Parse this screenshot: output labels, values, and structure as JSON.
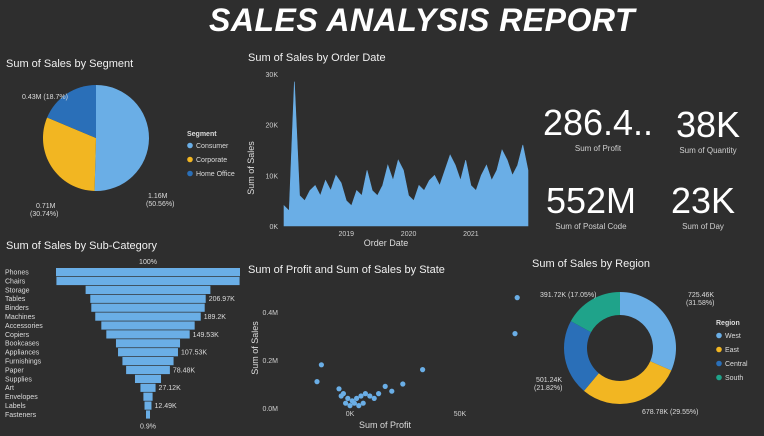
{
  "report_title": "SALES ANALYSIS REPORT",
  "colors": {
    "background": "#2e2e2e",
    "light_blue": "#6aaee6",
    "gold": "#f2b622",
    "mid_blue": "#2a6fb8",
    "teal": "#1fa38a"
  },
  "segment_chart": {
    "title": "Sum of Sales by Segment",
    "legend_title": "Segment",
    "chart_data": {
      "type": "pie",
      "title": "Sum of Sales by Segment",
      "categories": [
        "Consumer",
        "Corporate",
        "Home Office"
      ],
      "values": [
        1.16,
        0.71,
        0.43
      ],
      "value_labels": [
        "1.16M",
        "0.71M",
        "0.43M"
      ],
      "percent_labels": [
        "(50.56%)",
        "(30.74%)",
        "(18.7%)"
      ],
      "unit": "M"
    },
    "slice_labels": {
      "consumer_value": "1.16M",
      "consumer_pct": "(50.56%)",
      "corporate_value": "0.71M",
      "corporate_pct": "(30.74%)",
      "home_office": "0.43M (18.7%)"
    }
  },
  "order_date_chart": {
    "title": "Sum of Sales by Order Date",
    "xlabel": "Order Date",
    "ylabel": "Sum of Sales",
    "y_ticks": [
      "30K",
      "20K",
      "10K",
      "0K"
    ],
    "x_ticks": [
      "2019",
      "2020",
      "2021"
    ],
    "chart_data": {
      "type": "area",
      "title": "Sum of Sales by Order Date",
      "xlabel": "Order Date",
      "ylabel": "Sum of Sales",
      "ylim": [
        0,
        30000
      ],
      "x_range": [
        "2018-01",
        "2021-12"
      ],
      "series": [
        {
          "x": [
            "2018-01",
            "2018-02",
            "2018-03",
            "2018-04",
            "2018-05",
            "2018-06",
            "2018-07",
            "2018-08",
            "2018-09",
            "2018-10",
            "2018-11",
            "2018-12",
            "2019-01",
            "2019-02",
            "2019-03",
            "2019-04",
            "2019-05",
            "2019-06",
            "2019-07",
            "2019-08",
            "2019-09",
            "2019-10",
            "2019-11",
            "2019-12",
            "2020-01",
            "2020-02",
            "2020-03",
            "2020-04",
            "2020-05",
            "2020-06",
            "2020-07",
            "2020-08",
            "2020-09",
            "2020-10",
            "2020-11",
            "2020-12",
            "2021-01",
            "2021-02",
            "2021-03",
            "2021-04",
            "2021-05",
            "2021-06",
            "2021-07",
            "2021-08",
            "2021-09",
            "2021-10",
            "2021-11",
            "2021-12"
          ],
          "values": [
            4000,
            3000,
            28500,
            6000,
            5000,
            7000,
            8000,
            6000,
            9000,
            7000,
            10000,
            8500,
            5000,
            4000,
            7000,
            6000,
            11000,
            7000,
            6000,
            8000,
            12000,
            9000,
            13000,
            11000,
            6000,
            5000,
            8000,
            7000,
            9000,
            10000,
            8000,
            11000,
            14000,
            12000,
            9000,
            13000,
            8000,
            7000,
            10000,
            12000,
            9000,
            11000,
            15000,
            13000,
            10000,
            12000,
            16000,
            11000
          ]
        }
      ]
    }
  },
  "kpis": [
    {
      "value": "286.4..",
      "label": "Sum of Profit"
    },
    {
      "value": "38K",
      "label": "Sum of Quantity"
    },
    {
      "value": "552M",
      "label": "Sum of Postal Code"
    },
    {
      "value": "23K",
      "label": "Sum of Day"
    }
  ],
  "subcategory_chart": {
    "title": "Sum of Sales by Sub-Category",
    "chart_data": {
      "type": "bar",
      "title": "Sum of Sales by Sub-Category",
      "categories": [
        "Phones",
        "Chairs",
        "Storage",
        "Tables",
        "Binders",
        "Machines",
        "Accessories",
        "Copiers",
        "Bookcases",
        "Appliances",
        "Furnishings",
        "Paper",
        "Supplies",
        "Art",
        "Envelopes",
        "Labels",
        "Fasteners"
      ],
      "values": [
        330.0,
        328.5,
        223.8,
        206.97,
        203.4,
        189.2,
        167.4,
        149.53,
        114.9,
        107.53,
        91.7,
        78.48,
        46.7,
        27.12,
        16.5,
        12.49,
        3.0
      ],
      "unit": "K",
      "data_labels": {
        "0": "100%",
        "3": "206.97K",
        "5": "189.2K",
        "7": "149.53K",
        "9": "107.53K",
        "11": "78.48K",
        "13": "27.12K",
        "15": "12.49K",
        "16": "0.9%"
      }
    }
  },
  "state_chart": {
    "title": "Sum of Profit and Sum of Sales by State",
    "xlabel": "Sum of Profit",
    "ylabel": "Sum of Sales",
    "y_ticks": [
      "0.4M",
      "0.2M",
      "0.0M"
    ],
    "x_ticks": [
      "0K",
      "50K"
    ],
    "chart_data": {
      "type": "scatter",
      "title": "Sum of Profit and Sum of Sales by State",
      "xlabel": "Sum of Profit",
      "ylabel": "Sum of Sales",
      "xlim": [
        -30000,
        80000
      ],
      "ylim": [
        0,
        0.5
      ],
      "points": [
        [
          76000,
          0.46
        ],
        [
          75000,
          0.31
        ],
        [
          -13000,
          0.18
        ],
        [
          -15000,
          0.11
        ],
        [
          -5000,
          0.08
        ],
        [
          -3000,
          0.06
        ],
        [
          -1000,
          0.04
        ],
        [
          1000,
          0.03
        ],
        [
          3000,
          0.04
        ],
        [
          5000,
          0.05
        ],
        [
          7000,
          0.06
        ],
        [
          9000,
          0.05
        ],
        [
          11000,
          0.04
        ],
        [
          13000,
          0.06
        ],
        [
          16000,
          0.09
        ],
        [
          19000,
          0.07
        ],
        [
          24000,
          0.1
        ],
        [
          33000,
          0.16
        ],
        [
          2000,
          0.02
        ],
        [
          -2000,
          0.02
        ],
        [
          0,
          0.01
        ],
        [
          4000,
          0.01
        ],
        [
          6000,
          0.02
        ],
        [
          -4000,
          0.05
        ]
      ]
    }
  },
  "region_chart": {
    "title": "Sum of Sales by Region",
    "legend_title": "Region",
    "chart_data": {
      "type": "pie",
      "title": "Sum of Sales by Region",
      "categories": [
        "West",
        "East",
        "Central",
        "South"
      ],
      "values": [
        725.46,
        678.78,
        501.24,
        391.72
      ],
      "value_labels": [
        "725.46K",
        "678.78K",
        "501.24K",
        "391.72K"
      ],
      "percent_labels": [
        "(31.58%)",
        "(29.55%)",
        "(21.82%)",
        "(17.05%)"
      ],
      "unit": "K"
    },
    "slice_labels": {
      "west_value": "725.46K",
      "west_pct": "(31.58%)",
      "east": "678.78K (29.55%)",
      "central_value": "501.24K",
      "central_pct": "(21.82%)",
      "south": "391.72K (17.05%)"
    }
  }
}
